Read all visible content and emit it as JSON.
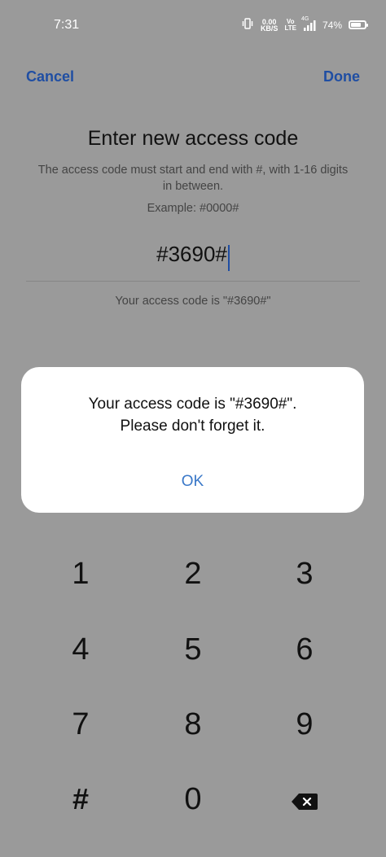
{
  "status": {
    "time": "7:31",
    "netspeed_value": "0.00",
    "netspeed_unit": "KB/S",
    "volte_top": "Vo",
    "volte_bottom": "LTE",
    "signal_label": "4G",
    "battery": "74%",
    "battery_level": 0.74
  },
  "topbar": {
    "cancel_label": "Cancel",
    "done_label": "Done"
  },
  "main": {
    "title": "Enter new access code",
    "description": "The access code must start and end with #, with 1-16 digits in between.",
    "example": "Example: #0000#",
    "code_value": "#3690#",
    "hint": "Your access code is \"#3690#\""
  },
  "dialog": {
    "message_line1": "Your access code is \"#3690#\".",
    "message_line2": "Please don't forget it.",
    "ok_label": "OK"
  },
  "keypad": {
    "k1": "1",
    "k2": "2",
    "k3": "3",
    "k4": "4",
    "k5": "5",
    "k6": "6",
    "k7": "7",
    "k8": "8",
    "k9": "9",
    "khash": "#",
    "k0": "0",
    "backspace_icon": "backspace-icon"
  },
  "colors": {
    "accent": "#1f4ea3",
    "dialog_button": "#3a78c8",
    "overlay_background": "#9a9a9a"
  }
}
